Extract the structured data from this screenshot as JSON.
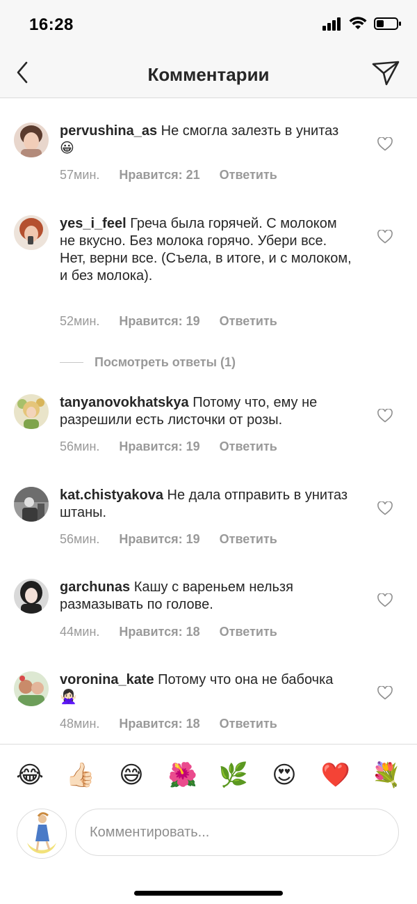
{
  "status_bar": {
    "time": "16:28"
  },
  "header": {
    "title": "Комментарии"
  },
  "comments": [
    {
      "username": "pervushina_as",
      "text": "Не смогла залезть в унитаз😀",
      "time": "57мин.",
      "likes": "Нравится: 21",
      "reply": "Ответить",
      "avatar_color": "#d7b8a6"
    },
    {
      "username": "yes_i_feel",
      "text": "Греча была горячей. С молоком не вкусно. Без молока горячо. Убери все. Нет, верни все. (Съела, в итоге, и с молоком, и без молока).",
      "time": "52мин.",
      "likes": "Нравится: 19",
      "reply": "Ответить",
      "avatar_color": "#b45a3c"
    },
    {
      "username": "tanyanovokhatskya",
      "text": "Потому что, ему не разрешили есть листочки от розы.",
      "time": "56мин.",
      "likes": "Нравится: 19",
      "reply": "Ответить",
      "avatar_color": "#d8c67a"
    },
    {
      "username": "kat.chistyakova",
      "text": "Не дала отправить в унитаз штаны.",
      "time": "56мин.",
      "likes": "Нравится: 19",
      "reply": "Ответить",
      "avatar_color": "#5c5c5c"
    },
    {
      "username": "garchunas",
      "text": "Кашу с вареньем нельзя размазывать по голове.",
      "time": "44мин.",
      "likes": "Нравится: 18",
      "reply": "Ответить",
      "avatar_color": "#2b2b2b"
    },
    {
      "username": "voronina_kate",
      "text": "Потому что она не бабочка 🙅🏻‍♀️",
      "time": "48мин.",
      "likes": "Нравится: 18",
      "reply": "Ответить",
      "avatar_color": "#c98b6a"
    }
  ],
  "view_replies": "Посмотреть ответы (1)",
  "emoji_bar": [
    "😂",
    "👍🏻",
    "😅",
    "🌺",
    "🌿",
    "😍",
    "❤️",
    "💐"
  ],
  "composer": {
    "placeholder": "Комментировать..."
  },
  "colors": {
    "text": "#262626",
    "secondary": "#999999",
    "border": "#dbdbdb",
    "bar_background": "#f7f7f7"
  }
}
